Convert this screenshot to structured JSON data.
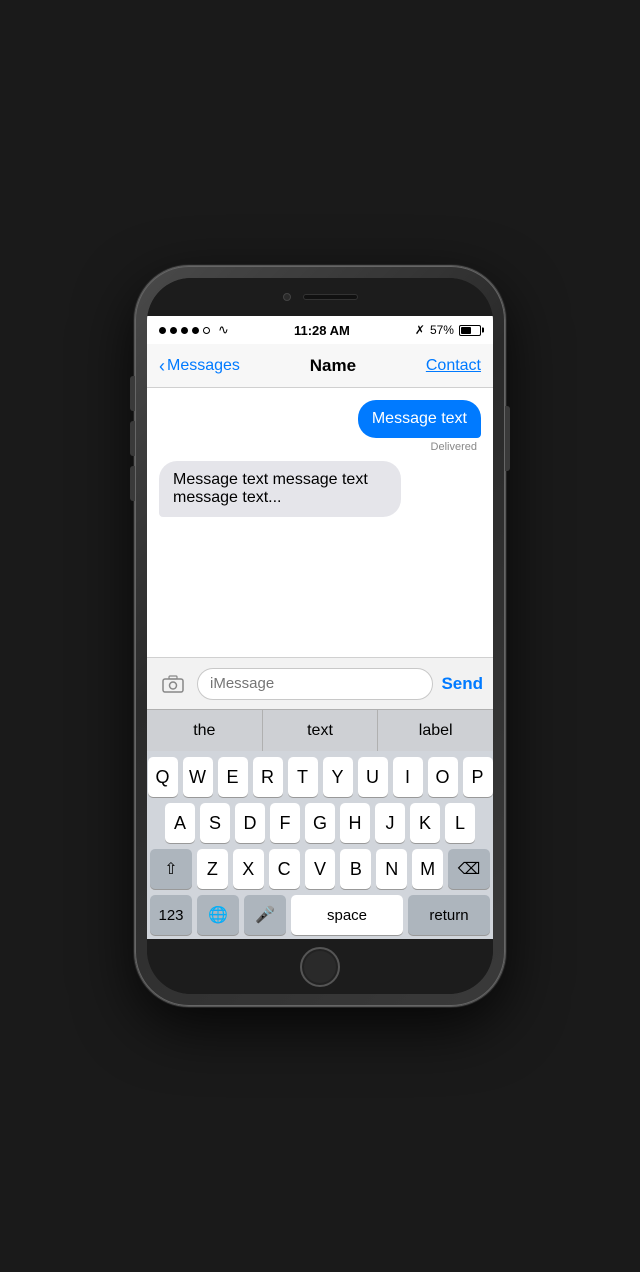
{
  "status_bar": {
    "time": "11:28 AM",
    "battery_percent": "57%",
    "signal_dots": [
      "filled",
      "filled",
      "filled",
      "filled",
      "empty"
    ]
  },
  "nav": {
    "back_label": "Messages",
    "title": "Name",
    "contact_label": "Contact"
  },
  "messages": [
    {
      "id": "sent-1",
      "type": "sent",
      "text": "Message text",
      "status": "Delivered"
    },
    {
      "id": "received-1",
      "type": "received",
      "text": "Message text message text message text..."
    }
  ],
  "input": {
    "placeholder": "iMessage",
    "send_label": "Send"
  },
  "autocomplete": {
    "items": [
      "the",
      "text",
      "label"
    ]
  },
  "keyboard": {
    "rows": [
      [
        "Q",
        "W",
        "E",
        "R",
        "T",
        "Y",
        "U",
        "I",
        "O",
        "P"
      ],
      [
        "A",
        "S",
        "D",
        "F",
        "G",
        "H",
        "J",
        "K",
        "L"
      ],
      [
        "⇧",
        "Z",
        "X",
        "C",
        "V",
        "B",
        "N",
        "M",
        "⌫"
      ],
      [
        "123",
        "🌐",
        "🎤",
        "space",
        "return"
      ]
    ],
    "space_label": "space",
    "return_label": "return",
    "numbers_label": "123"
  }
}
